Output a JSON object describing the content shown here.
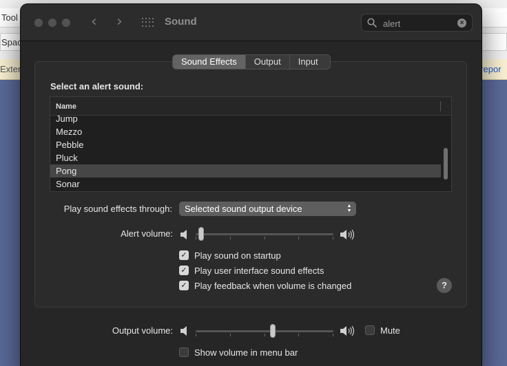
{
  "background": {
    "toolbar_text": "Tool",
    "address_text": "Spac",
    "banner_text": "Extens",
    "banner_link": "t repor"
  },
  "window": {
    "title": "Sound",
    "search": {
      "value": "alert"
    },
    "tabs": [
      {
        "label": "Sound Effects",
        "active": true
      },
      {
        "label": "Output",
        "active": false
      },
      {
        "label": "Input",
        "active": false
      }
    ]
  },
  "sound_effects": {
    "heading": "Select an alert sound:",
    "list_header": "Name",
    "sounds": [
      "Jump",
      "Mezzo",
      "Pebble",
      "Pluck",
      "Pong",
      "Sonar"
    ],
    "selected_sound": "Pong",
    "play_through_label": "Play sound effects through:",
    "play_through_value": "Selected sound output device",
    "alert_volume_label": "Alert volume:",
    "alert_volume_level": 0.02,
    "options": [
      {
        "label": "Play sound on startup",
        "checked": true
      },
      {
        "label": "Play user interface sound effects",
        "checked": true
      },
      {
        "label": "Play feedback when volume is changed",
        "checked": true
      }
    ],
    "help_glyph": "?"
  },
  "output": {
    "label": "Output volume:",
    "level": 0.56,
    "mute_label": "Mute",
    "mute_checked": false,
    "menu_bar_label": "Show volume in menu bar",
    "menu_bar_checked": false
  },
  "colors": {
    "window_bg": "#262626",
    "selection": "#464646",
    "desktop": "#5b6a99"
  }
}
